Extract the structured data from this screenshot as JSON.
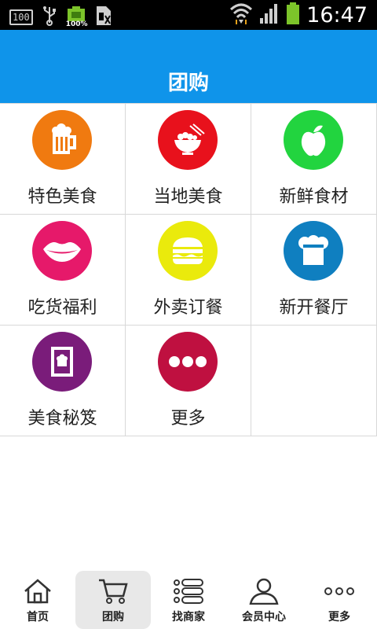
{
  "status_bar": {
    "left_badge": "100",
    "battery_percent_label": "100%",
    "clock": "16:47"
  },
  "header": {
    "title": "团购"
  },
  "grid": [
    {
      "label": "特色美食",
      "icon": "beer-mug-icon",
      "color": "#f07a10"
    },
    {
      "label": "当地美食",
      "icon": "noodle-bowl-icon",
      "color": "#e8111c"
    },
    {
      "label": "新鲜食材",
      "icon": "apple-icon",
      "color": "#22d43f"
    },
    {
      "label": "吃货福利",
      "icon": "lips-icon",
      "color": "#e6196a"
    },
    {
      "label": "外卖订餐",
      "icon": "burger-icon",
      "color": "#eaea0c"
    },
    {
      "label": "新开餐厅",
      "icon": "chef-hat-icon",
      "color": "#0f7fc0"
    },
    {
      "label": "美食秘笈",
      "icon": "recipe-book-icon",
      "color": "#7a1c7a"
    },
    {
      "label": "更多",
      "icon": "more-dots-icon",
      "color": "#bf1040"
    }
  ],
  "bottom_nav": [
    {
      "label": "首页",
      "icon": "home-icon",
      "active": false
    },
    {
      "label": "团购",
      "icon": "cart-icon",
      "active": true
    },
    {
      "label": "找商家",
      "icon": "list-icon",
      "active": false
    },
    {
      "label": "会员中心",
      "icon": "user-icon",
      "active": false
    },
    {
      "label": "更多",
      "icon": "more-icon",
      "active": false
    }
  ],
  "colors": {
    "header_bg": "#0f94ea",
    "active_tab_bg": "#e8e8e8"
  }
}
